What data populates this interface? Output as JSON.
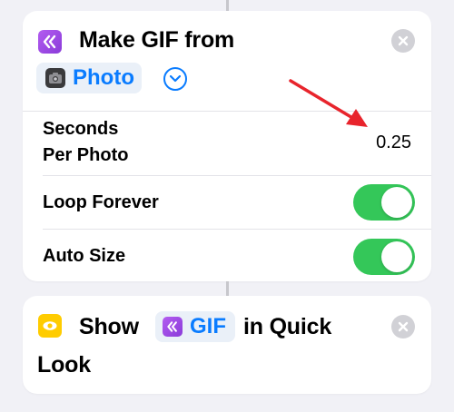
{
  "make_gif": {
    "title": "Make GIF from",
    "input_token": {
      "label": "Photo",
      "icon": "camera-icon"
    },
    "rows": {
      "seconds_per_photo": {
        "label_line1": "Seconds",
        "label_line2": "Per Photo",
        "value": "0.25"
      },
      "loop_forever": {
        "label": "Loop Forever",
        "on": true
      },
      "auto_size": {
        "label": "Auto Size",
        "on": true
      }
    }
  },
  "show_action": {
    "title_prefix": "Show",
    "token_label": "GIF",
    "title_suffix": "in Quick",
    "title_line2": "Look"
  },
  "colors": {
    "accent": "#0a7cff",
    "toggle_on": "#34c759",
    "action_purple": "#9b4be6",
    "action_yellow": "#ffcc00",
    "annotation_arrow": "#e8242c"
  }
}
